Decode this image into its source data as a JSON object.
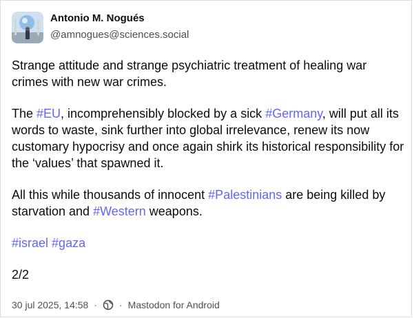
{
  "author": {
    "display_name": "Antonio M. Nogués",
    "handle": "@amnogues@sciences.social"
  },
  "post": {
    "p1": "Strange attitude and strange psychiatric treatment of healing war crimes with new war crimes.",
    "p2": {
      "t1": "The ",
      "tag1": "#EU",
      "t2": ", incomprehensibly blocked by a sick ",
      "tag2": "#Germany",
      "t3": ", will put all its words to waste, sink further into global irrelevance, renew its now customary hypocrisy and once again shirk its historical responsibility for the ‘values’ that spawned it."
    },
    "p3": {
      "t1": "All this while thousands of innocent ",
      "tag1": "#Palestinians",
      "t2": " are being killed by starvation and ",
      "tag2": "#Western",
      "t3": " weapons."
    },
    "p4": {
      "tag1": "#israel",
      "tag2": "#gaza"
    },
    "p5": "2/2"
  },
  "meta": {
    "timestamp": "30 jul 2025, 14:58",
    "separator": "·",
    "visibility_icon": "globe-icon",
    "client": "Mastodon for Android"
  },
  "colors": {
    "hashtag": "#6364ff",
    "text": "#0b0b10",
    "muted": "#4f4f5c",
    "border": "#dcdce3"
  }
}
